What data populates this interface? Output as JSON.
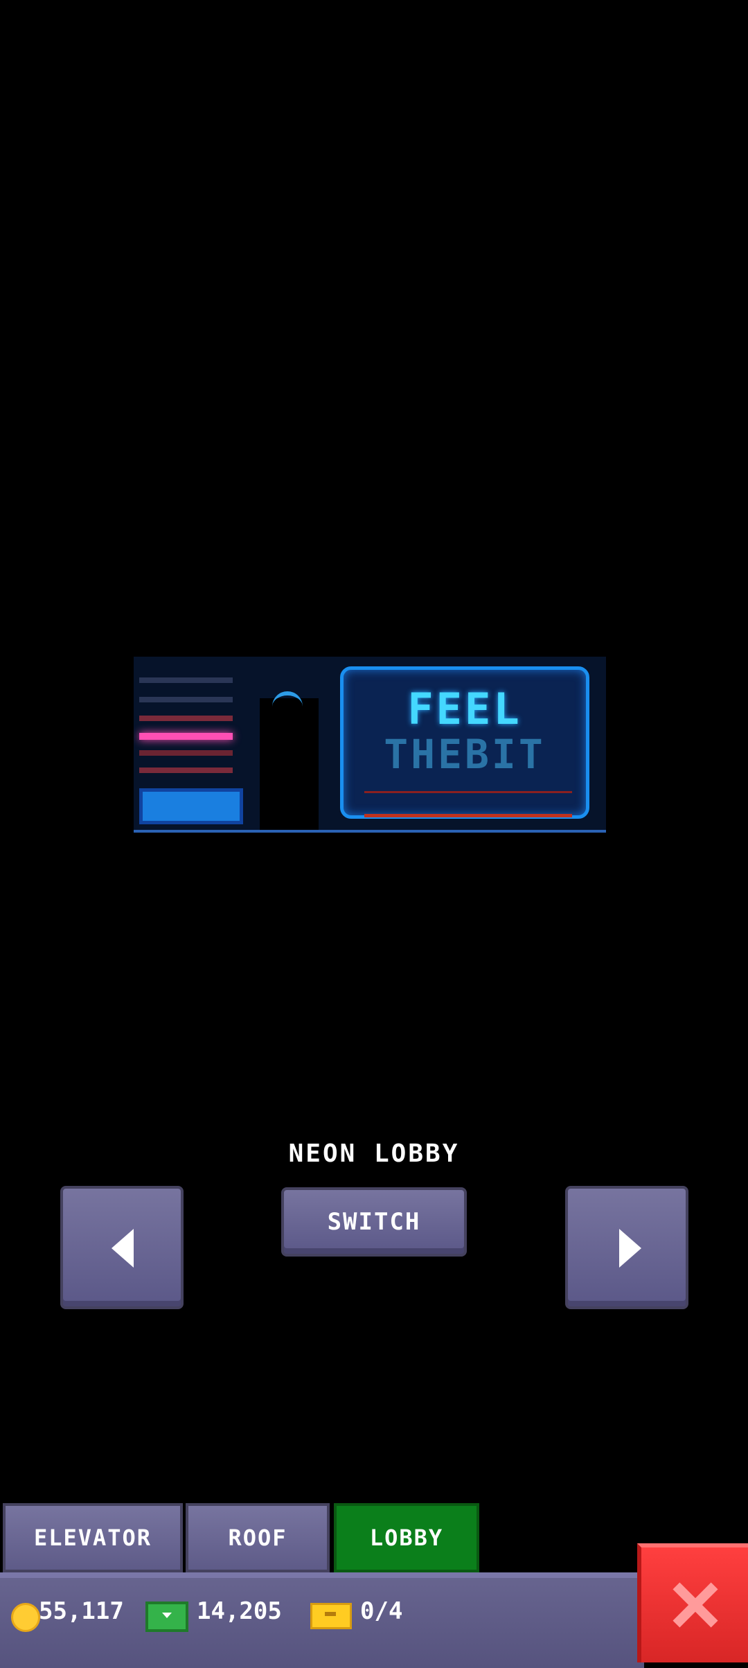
{
  "preview": {
    "sign_line1": "FEEL",
    "sign_line2": "THEBIT"
  },
  "theme": {
    "name": "NEON LOBBY",
    "switch_label": "SWITCH"
  },
  "tabs": [
    {
      "label": "ELEVATOR",
      "selected": false
    },
    {
      "label": "ROOF",
      "selected": false
    },
    {
      "label": "LOBBY",
      "selected": true
    }
  ],
  "currency": {
    "coins": "55,117",
    "bux": "14,205",
    "tickets": "0/4"
  },
  "icons": {
    "prev": "left-arrow-icon",
    "next": "right-arrow-icon",
    "close": "close-icon",
    "coin": "coin-icon",
    "cash": "bux-icon",
    "ticket": "ticket-icon"
  },
  "colors": {
    "button": "#6a6796",
    "tab_selected": "#0b7f1b",
    "close": "#e12d2d",
    "neon_pink": "#ff4fb4",
    "neon_cyan": "#44d8ff"
  }
}
